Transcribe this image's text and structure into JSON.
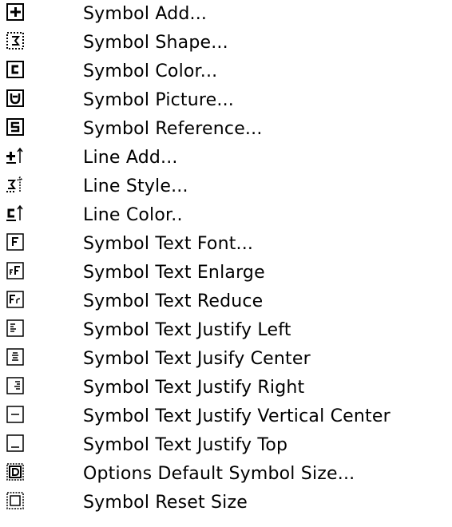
{
  "toolbar_legend": {
    "items": [
      {
        "icon": "symbol-add-icon",
        "label": "Symbol Add..."
      },
      {
        "icon": "symbol-shape-icon",
        "label": "Symbol Shape..."
      },
      {
        "icon": "symbol-color-icon",
        "label": "Symbol Color..."
      },
      {
        "icon": "symbol-picture-icon",
        "label": "Symbol Picture..."
      },
      {
        "icon": "symbol-reference-icon",
        "label": "Symbol Reference..."
      },
      {
        "icon": "line-add-icon",
        "label": "Line Add..."
      },
      {
        "icon": "line-style-icon",
        "label": "Line Style..."
      },
      {
        "icon": "line-color-icon",
        "label": "Line Color.."
      },
      {
        "icon": "symbol-text-font-icon",
        "label": "Symbol Text Font..."
      },
      {
        "icon": "symbol-text-enlarge-icon",
        "label": "Symbol Text Enlarge"
      },
      {
        "icon": "symbol-text-reduce-icon",
        "label": "Symbol Text Reduce"
      },
      {
        "icon": "justify-left-icon",
        "label": "Symbol Text Justify Left"
      },
      {
        "icon": "justify-center-icon",
        "label": "Symbol Text Jusify Center"
      },
      {
        "icon": "justify-right-icon",
        "label": "Symbol Text Justify Right"
      },
      {
        "icon": "justify-vertical-center-icon",
        "label": "Symbol Text Justify Vertical Center"
      },
      {
        "icon": "justify-top-icon",
        "label": "Symbol Text Justify Top"
      },
      {
        "icon": "default-symbol-size-icon",
        "label": "Options Default Symbol Size..."
      },
      {
        "icon": "symbol-reset-size-icon",
        "label": "Symbol Reset Size"
      }
    ]
  }
}
